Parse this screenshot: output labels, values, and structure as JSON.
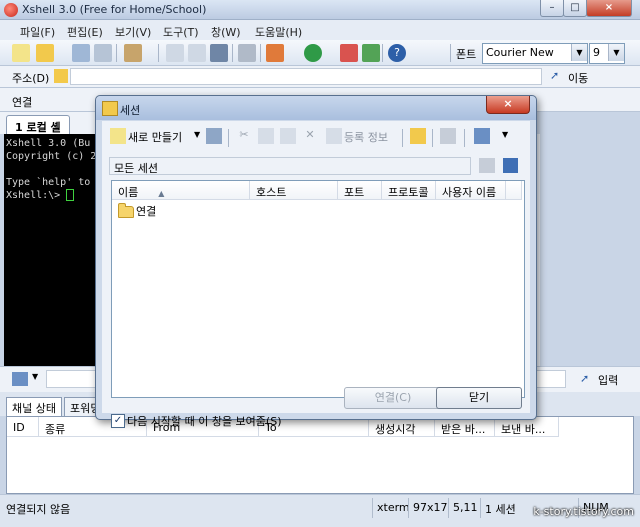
{
  "window": {
    "title": "Xshell 3.0 (Free for Home/School)",
    "minimize": "–",
    "maximize": "□",
    "close": "×"
  },
  "menu": [
    "파일(F)",
    "편집(E)",
    "보기(V)",
    "도구(T)",
    "창(W)",
    "도움말(H)"
  ],
  "toolbar": {
    "font_label": "폰트",
    "font_value": "Courier New",
    "font_size": "9"
  },
  "address": {
    "label": "주소(D)",
    "go_label": "이동"
  },
  "links": {
    "label": "연결"
  },
  "terminal": {
    "tab_label": "1 로컬 셸",
    "lines": [
      "Xshell 3.0 (Bu",
      "Copyright (c) 2",
      "",
      "Type `help' to",
      "Xshell:\\> "
    ]
  },
  "command": {
    "input_label": "입력"
  },
  "panel": {
    "tabs": [
      "채널 상태",
      "포워딩"
    ],
    "columns": [
      "ID",
      "종류",
      "From",
      "To",
      "생성시각",
      "받은 바...",
      "보낸 바..."
    ]
  },
  "status": {
    "left": "연결되지 않음",
    "term": "xterm",
    "size": "97x17",
    "pos": "5,11",
    "sessions": "1 세션",
    "num": "NUM",
    "watermark": "k-story.tistory.com"
  },
  "dialog": {
    "title": "세션",
    "close": "×",
    "new_label": "새로 만들기",
    "register_label": "등록 정보",
    "path": "모든 세션",
    "columns": [
      "이름",
      "호스트",
      "포트",
      "프로토콜",
      "사용자 이름"
    ],
    "items": [
      {
        "name": "연결"
      }
    ],
    "show_on_start": "다음 시작할 때 이 창을 보여줌(S)",
    "show_on_start_checked": true,
    "connect_label": "연결(C)",
    "close_label": "닫기"
  },
  "colors": {
    "accent": "#cdd9ea",
    "terminal_bg": "#000000",
    "cursor": "#3fd13f"
  }
}
